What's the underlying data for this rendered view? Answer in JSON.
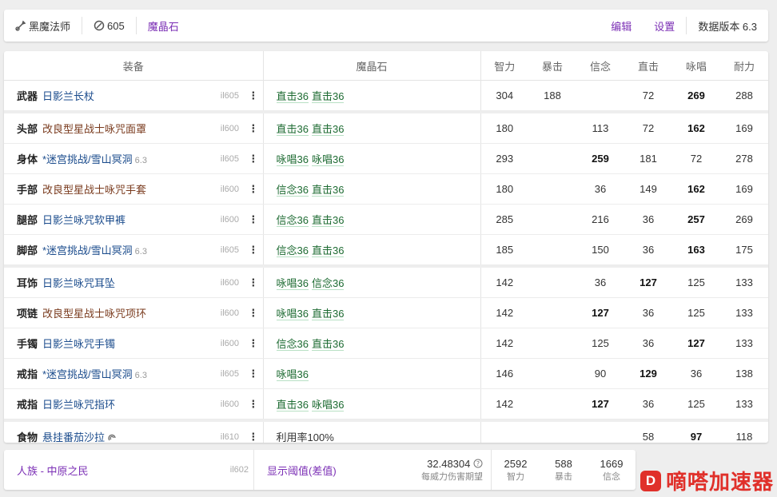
{
  "header": {
    "job": "黑魔法师",
    "item_level": "605",
    "materia_link": "魔晶石",
    "edit": "编辑",
    "settings": "设置",
    "data_version": "数据版本 6.3",
    "job_icon": "sword-icon",
    "il_icon": "item-level-icon"
  },
  "table": {
    "headers": {
      "gear": "装备",
      "materia": "魔晶石",
      "int": "智力",
      "crit": "暴击",
      "det": "信念",
      "dh": "直击",
      "sps": "咏唱",
      "pie": "耐力"
    },
    "rows": [
      {
        "slot": "武器",
        "name": "日影兰长杖",
        "ver": "",
        "il": "il605",
        "mats": [
          "直击36",
          "直击36"
        ],
        "int": "304",
        "crit": "188",
        "det": "",
        "dh": "72",
        "sps": "269",
        "pie": "288",
        "bold": "sps",
        "gap_after": true
      },
      {
        "slot": "头部",
        "name": "改良型星战士咏咒面罩",
        "ver": "",
        "il": "il600",
        "mats": [
          "直击36",
          "直击36"
        ],
        "int": "180",
        "crit": "",
        "det": "113",
        "dh": "72",
        "sps": "162",
        "pie": "169",
        "bold": "sps",
        "alt": true
      },
      {
        "slot": "身体",
        "name": "*迷宫挑战/雪山冥洞",
        "ver": "6.3",
        "il": "il605",
        "mats": [
          "咏唱36",
          "咏唱36"
        ],
        "int": "293",
        "crit": "",
        "det": "259",
        "dh": "181",
        "sps": "72",
        "pie": "278",
        "bold": "det"
      },
      {
        "slot": "手部",
        "name": "改良型星战士咏咒手套",
        "ver": "",
        "il": "il600",
        "mats": [
          "信念36",
          "直击36"
        ],
        "int": "180",
        "crit": "",
        "det": "36",
        "dh": "149",
        "sps": "162",
        "pie": "169",
        "bold": "sps",
        "alt": true
      },
      {
        "slot": "腿部",
        "name": "日影兰咏咒软甲裤",
        "ver": "",
        "il": "il600",
        "mats": [
          "信念36",
          "直击36"
        ],
        "int": "285",
        "crit": "",
        "det": "216",
        "dh": "36",
        "sps": "257",
        "pie": "269",
        "bold": "sps"
      },
      {
        "slot": "脚部",
        "name": "*迷宫挑战/雪山冥洞",
        "ver": "6.3",
        "il": "il605",
        "mats": [
          "信念36",
          "直击36"
        ],
        "int": "185",
        "crit": "",
        "det": "150",
        "dh": "36",
        "sps": "163",
        "pie": "175",
        "bold": "sps",
        "gap_after": true
      },
      {
        "slot": "耳饰",
        "name": "日影兰咏咒耳坠",
        "ver": "",
        "il": "il600",
        "mats": [
          "咏唱36",
          "信念36"
        ],
        "int": "142",
        "crit": "",
        "det": "36",
        "dh": "127",
        "sps": "125",
        "pie": "133",
        "bold": "dh"
      },
      {
        "slot": "项链",
        "name": "改良型星战士咏咒项环",
        "ver": "",
        "il": "il600",
        "mats": [
          "咏唱36",
          "直击36"
        ],
        "int": "142",
        "crit": "",
        "det": "127",
        "dh": "36",
        "sps": "125",
        "pie": "133",
        "bold": "det",
        "alt": true
      },
      {
        "slot": "手镯",
        "name": "日影兰咏咒手镯",
        "ver": "",
        "il": "il600",
        "mats": [
          "信念36",
          "直击36"
        ],
        "int": "142",
        "crit": "",
        "det": "125",
        "dh": "36",
        "sps": "127",
        "pie": "133",
        "bold": "sps"
      },
      {
        "slot": "戒指",
        "name": "*迷宫挑战/雪山冥洞",
        "ver": "6.3",
        "il": "il605",
        "mats": [
          "咏唱36"
        ],
        "int": "146",
        "crit": "",
        "det": "90",
        "dh": "129",
        "sps": "36",
        "pie": "138",
        "bold": "dh"
      },
      {
        "slot": "戒指",
        "name": "日影兰咏咒指环",
        "ver": "",
        "il": "il600",
        "mats": [
          "直击36",
          "咏唱36"
        ],
        "int": "142",
        "crit": "",
        "det": "127",
        "dh": "36",
        "sps": "125",
        "pie": "133",
        "bold": "det",
        "gap_after": true
      },
      {
        "slot": "食物",
        "name": "悬挂番茄沙拉",
        "ver": "",
        "il": "il610",
        "mats": [],
        "mat_text": "利用率100%",
        "int": "",
        "crit": "",
        "det": "",
        "dh": "58",
        "sps": "97",
        "pie": "118",
        "bold": "sps",
        "hq": true
      }
    ]
  },
  "footer": {
    "race": "人族 - 中原之民",
    "il": "il602",
    "threshold": "显示阈值(差值)",
    "damage_value": "32.48304",
    "damage_label": "每威力伤害期望",
    "int_value": "2592",
    "int_label": "智力",
    "crit_value": "588",
    "crit_label": "暴击",
    "det_value": "1669",
    "det_label": "信念"
  },
  "watermark": {
    "text": "嘀嗒加速器",
    "logo": "D"
  }
}
